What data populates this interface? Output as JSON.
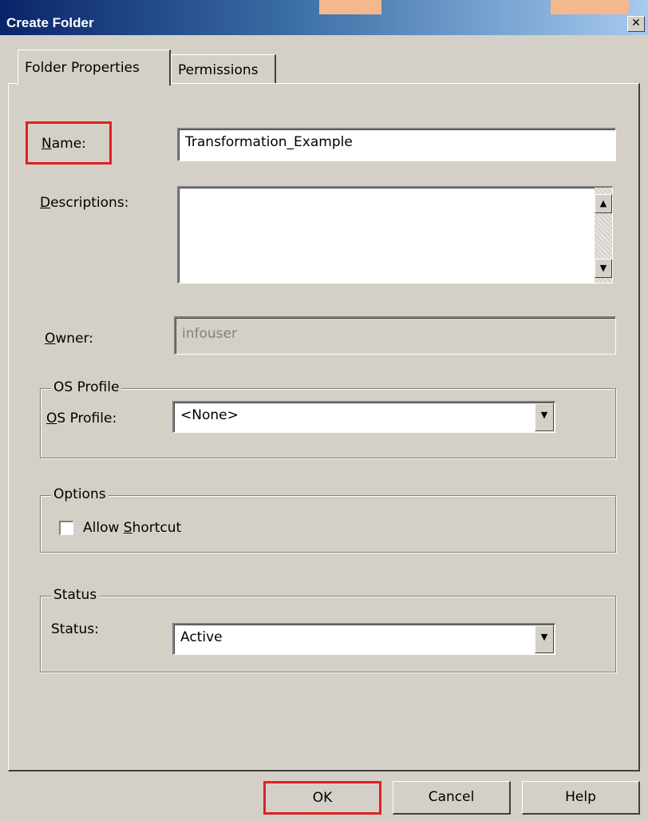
{
  "window": {
    "title": "Create Folder",
    "close_glyph": "✕"
  },
  "tabs": [
    {
      "label": "Folder Properties",
      "selected": true
    },
    {
      "label": "Permissions",
      "selected": false
    }
  ],
  "form": {
    "name": {
      "label_mnemonic": "N",
      "label_rest": "ame:",
      "value": "Transformation_Example"
    },
    "description": {
      "label_mnemonic": "D",
      "label_rest": "escriptions:",
      "value": ""
    },
    "owner": {
      "label_mnemonic": "O",
      "label_rest": "wner:",
      "value": "infouser"
    }
  },
  "os_profile_group": {
    "title": "OS Profile",
    "label_mnemonic": "O",
    "label_rest": "S Profile:",
    "selected": "<None>"
  },
  "options_group": {
    "title": "Options",
    "checkbox_label_before": "Allow ",
    "checkbox_label_mnemonic": "S",
    "checkbox_label_after": "hortcut",
    "checked": false
  },
  "status_group": {
    "title": "Status",
    "label": "Status:",
    "selected": "Active"
  },
  "buttons": {
    "ok": "OK",
    "cancel": "Cancel",
    "help": "Help"
  },
  "icons": {
    "scroll_up": "▲",
    "scroll_down": "▼",
    "dropdown": "▼"
  },
  "colors": {
    "highlight": "#e02020",
    "titlebar_start": "#0a246a",
    "titlebar_end": "#a6caf0",
    "dialog_bg": "#d4d0c8"
  }
}
